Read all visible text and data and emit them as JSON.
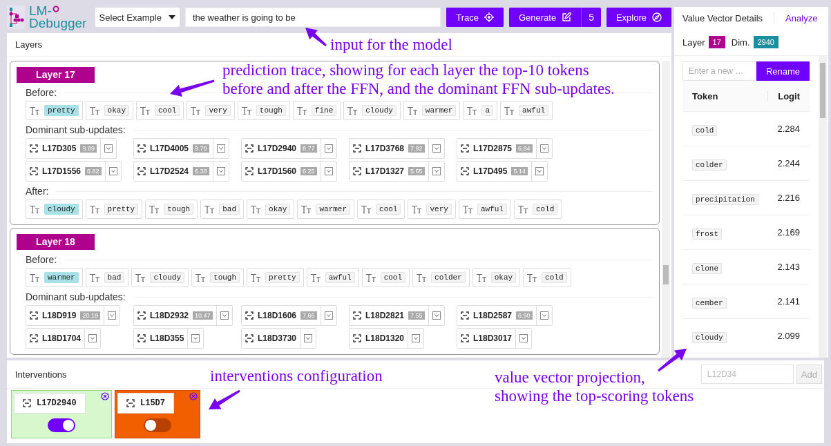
{
  "header": {
    "logo": {
      "line1": "LM-",
      "line2": "Debugger"
    },
    "example_select": "Select Example",
    "prompt": "the weather is going to be",
    "buttons": [
      {
        "kind": "trace",
        "label": "Trace"
      },
      {
        "kind": "generate",
        "label": "Generate",
        "count": "5"
      },
      {
        "kind": "explore",
        "label": "Explore"
      }
    ]
  },
  "layers_panel": {
    "title": "Layers",
    "layers": [
      {
        "label": "Layer 17",
        "sections": [
          {
            "kind": "tokens",
            "label": "Before:",
            "tokens": [
              {
                "text": "pretty",
                "highlighted": true
              },
              {
                "text": "okay",
                "highlighted": false
              },
              {
                "text": "cool",
                "highlighted": false
              },
              {
                "text": "very",
                "highlighted": false
              },
              {
                "text": "tough",
                "highlighted": false
              },
              {
                "text": "fine",
                "highlighted": false
              },
              {
                "text": "cloudy",
                "highlighted": false
              },
              {
                "text": "warmer",
                "highlighted": false
              },
              {
                "text": "a",
                "highlighted": false
              },
              {
                "text": "awful",
                "highlighted": false
              }
            ]
          },
          {
            "kind": "subupdates",
            "label": "Dominant sub-updates:",
            "items": [
              {
                "name": "L17D305",
                "score": "9.89"
              },
              {
                "name": "L17D4005",
                "score": "9.79"
              },
              {
                "name": "L17D2940",
                "score": "8.77"
              },
              {
                "name": "L17D3768",
                "score": "7.92"
              },
              {
                "name": "L17D2875",
                "score": "6.84"
              },
              {
                "name": "L17D1556",
                "score": "6.82"
              },
              {
                "name": "L17D2524",
                "score": "6.38"
              },
              {
                "name": "L17D1560",
                "score": "6.25"
              },
              {
                "name": "L17D1327",
                "score": "5.65"
              },
              {
                "name": "L17D495",
                "score": "5.14"
              }
            ]
          },
          {
            "kind": "tokens",
            "label": "After:",
            "tokens": [
              {
                "text": "cloudy",
                "highlighted": true
              },
              {
                "text": "pretty",
                "highlighted": false
              },
              {
                "text": "tough",
                "highlighted": false
              },
              {
                "text": "bad",
                "highlighted": false
              },
              {
                "text": "okay",
                "highlighted": false
              },
              {
                "text": "warmer",
                "highlighted": false
              },
              {
                "text": "cool",
                "highlighted": false
              },
              {
                "text": "very",
                "highlighted": false
              },
              {
                "text": "awful",
                "highlighted": false
              },
              {
                "text": "cold",
                "highlighted": false
              }
            ]
          }
        ]
      },
      {
        "label": "Layer 18",
        "sections": [
          {
            "kind": "tokens",
            "label": "Before:",
            "tokens": [
              {
                "text": "warmer",
                "highlighted": true
              },
              {
                "text": "bad",
                "highlighted": false
              },
              {
                "text": "cloudy",
                "highlighted": false
              },
              {
                "text": "tough",
                "highlighted": false
              },
              {
                "text": "pretty",
                "highlighted": false
              },
              {
                "text": "awful",
                "highlighted": false
              },
              {
                "text": "cool",
                "highlighted": false
              },
              {
                "text": "colder",
                "highlighted": false
              },
              {
                "text": "okay",
                "highlighted": false
              },
              {
                "text": "cold",
                "highlighted": false
              }
            ]
          },
          {
            "kind": "subupdates",
            "label": "Dominant sub-updates:",
            "items": [
              {
                "name": "L18D919",
                "score": "20.19"
              },
              {
                "name": "L18D2932",
                "score": "10.47"
              },
              {
                "name": "L18D1606",
                "score": "7.66"
              },
              {
                "name": "L18D2821",
                "score": "7.55"
              },
              {
                "name": "L18D2587",
                "score": "6.90"
              },
              {
                "name": "L18D1704"
              },
              {
                "name": "L18D355"
              },
              {
                "name": "L18D3730"
              },
              {
                "name": "L18D1320"
              },
              {
                "name": "L18D3017"
              }
            ]
          }
        ]
      }
    ]
  },
  "value_vector": {
    "tabs": [
      {
        "label": "Value Vector Details",
        "selected": true
      },
      {
        "label": "Analyze",
        "selected": false
      }
    ],
    "layer_label": "Layer",
    "layer": "17",
    "dim_label": "Dim.",
    "dim": "2940",
    "rename": {
      "placeholder": "Enter a new …",
      "button": "Rename"
    },
    "columns": [
      "Token",
      "Logit"
    ],
    "rows": [
      {
        "token": "cold",
        "logit": "2.284"
      },
      {
        "token": "colder",
        "logit": "2.244"
      },
      {
        "token": "precipitation",
        "logit": "2.216"
      },
      {
        "token": "frost",
        "logit": "2.169"
      },
      {
        "token": "clone",
        "logit": "2.143"
      },
      {
        "token": "cember",
        "logit": "2.141"
      },
      {
        "token": "cloudy",
        "logit": "2.099"
      }
    ]
  },
  "interventions": {
    "title": "Interventions",
    "add_field": {
      "placeholder": "L12D34"
    },
    "add_button": {
      "label": "Add",
      "disabled": true
    },
    "items": [
      {
        "name": "L17D2940",
        "on": true
      },
      {
        "name": "L15D7",
        "on": false
      }
    ]
  },
  "annotations": [
    {
      "lines": [
        "input for the model"
      ]
    },
    {
      "lines": [
        "prediction trace, showing for each layer the top-10 tokens",
        "before and after the FFN, and the dominant FFN sub-updates."
      ]
    },
    {
      "lines": [
        "interventions configuration"
      ]
    },
    {
      "lines": [
        "value vector projection,",
        "showing the top-scoring tokens"
      ]
    }
  ]
}
